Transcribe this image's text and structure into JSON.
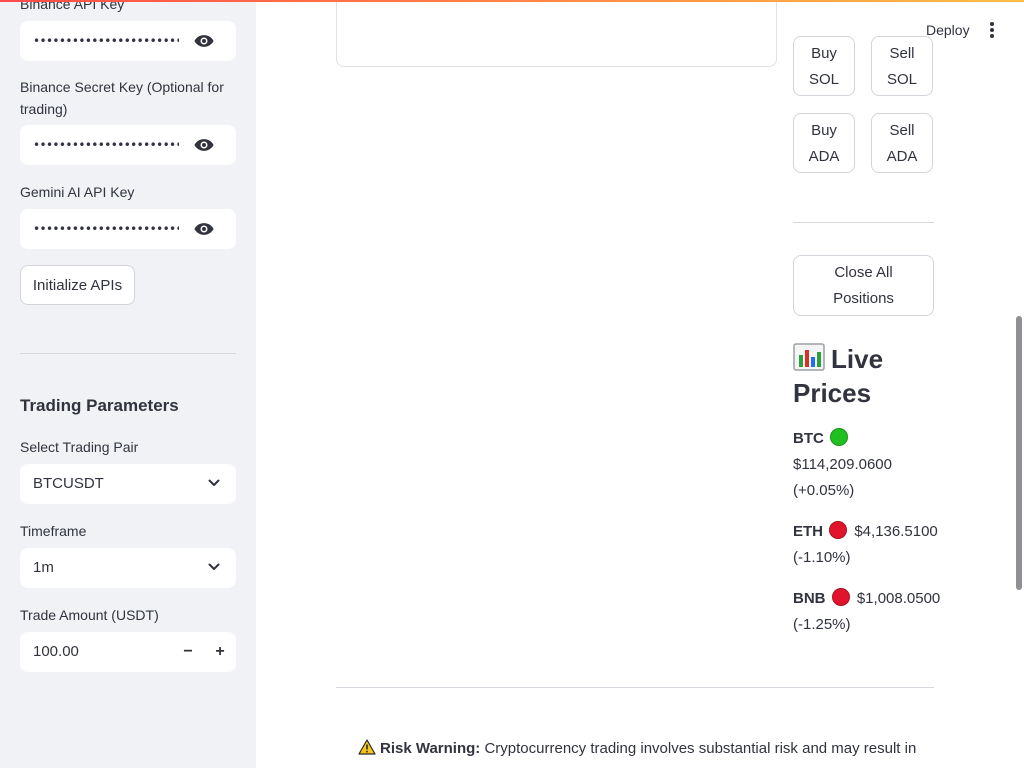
{
  "sidebar": {
    "binance_api_key_label": "Binance API Key",
    "binance_api_key_value": "••••••••••••••••••••••••••••••••",
    "binance_secret_label": "Binance Secret Key (Optional for trading)",
    "binance_secret_value": "••••••••••••••••••••••••••••••••",
    "gemini_key_label": "Gemini AI API Key",
    "gemini_key_value": "••••••••••••••••••••••••••••••••",
    "init_button": "Initialize APIs",
    "params_heading": "Trading Parameters",
    "pair_label": "Select Trading Pair",
    "pair_value": "BTCUSDT",
    "timeframe_label": "Timeframe",
    "timeframe_value": "1m",
    "amount_label": "Trade Amount (USDT)",
    "amount_value": "100.00",
    "stepper_minus": "−",
    "stepper_plus": "+"
  },
  "header": {
    "deploy": "Deploy"
  },
  "trade_buttons": {
    "buy_sol_line1": "Buy",
    "buy_sol_line2": "SOL",
    "sell_sol_line1": "Sell",
    "sell_sol_line2": "SOL",
    "buy_ada_line1": "Buy",
    "buy_ada_line2": "ADA",
    "sell_ada_line1": "Sell",
    "sell_ada_line2": "ADA"
  },
  "close_all": {
    "line1": "Close All",
    "line2": "Positions"
  },
  "live_prices": {
    "heading_line1": "Live",
    "heading_line2": "Prices",
    "items": [
      {
        "symbol": "BTC",
        "status": "up",
        "price": "$114,209.0600",
        "change": "(+0.05%)"
      },
      {
        "symbol": "ETH",
        "status": "down",
        "price": "$4,136.5100",
        "change": "(-1.10%)"
      },
      {
        "symbol": "BNB",
        "status": "down",
        "price": "$1,008.0500",
        "change": "(-1.25%)"
      }
    ]
  },
  "risk_warning": {
    "label": "Risk Warning:",
    "text": "Cryptocurrency trading involves substantial risk and may result in"
  },
  "colors": {
    "sidebar_bg": "#f0f2f6",
    "up": "#21c021",
    "down": "#e0142a",
    "warning": "#f5c518"
  }
}
